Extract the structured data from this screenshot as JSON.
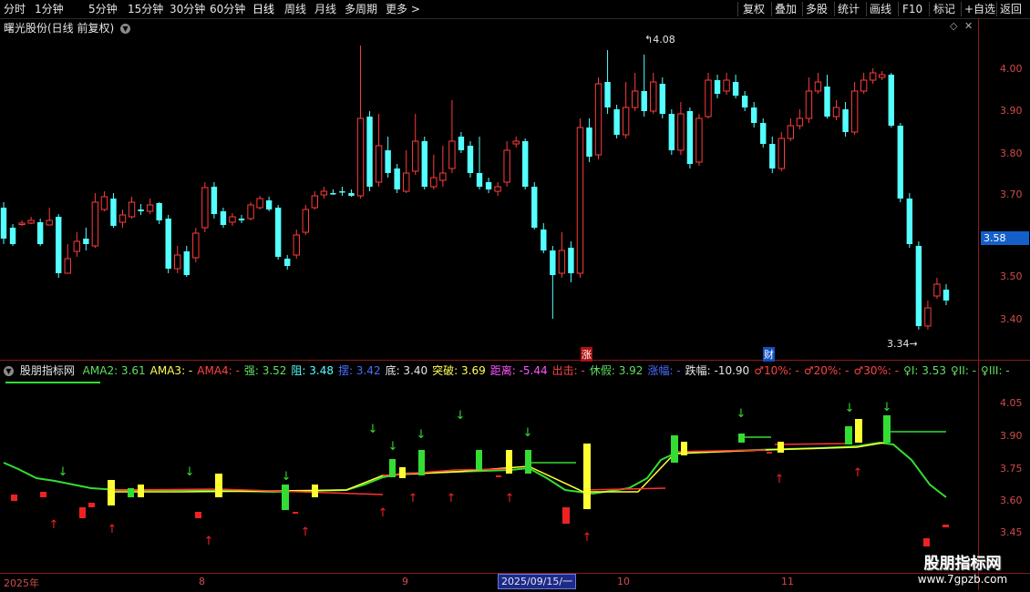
{
  "toolbar": {
    "periods": [
      "分时",
      "1分钟",
      "5分钟",
      "15分钟",
      "30分钟",
      "60分钟",
      "日线",
      "周线",
      "月线",
      "多周期",
      "更多 >"
    ],
    "active_period": "日线",
    "actions": [
      "复权",
      "叠加",
      "多股",
      "统计",
      "画线",
      "F10",
      "标记",
      "+自选",
      "返回"
    ]
  },
  "main_chart": {
    "title": "曙光股份(日线 前复权)",
    "high_label": "4.08",
    "low_label": "3.34",
    "price_tag": "3.58",
    "price_axis": [
      "4.00",
      "3.90",
      "3.80",
      "3.70",
      "3.60",
      "3.50",
      "3.40"
    ],
    "event_tags": [
      "涨",
      "财"
    ],
    "colors": {
      "up": "#ff3b3b",
      "down": "#54ffff",
      "grid": "#8b1a1a",
      "axis_text": "#d24b4b"
    }
  },
  "indicator": {
    "name": "股朋指标网",
    "values": [
      {
        "text": "AMA2: 3.61",
        "color": "#5fe05f"
      },
      {
        "text": "AMA3: -",
        "color": "#ffff55"
      },
      {
        "text": "AMA4: -",
        "color": "#ff4444"
      },
      {
        "text": "强: 3.52",
        "color": "#5fe05f"
      },
      {
        "text": "阻: 3.48",
        "color": "#55ffff"
      },
      {
        "text": "摆: 3.42",
        "color": "#4a6dff"
      },
      {
        "text": "底: 3.40",
        "color": "#e6e6e6"
      },
      {
        "text": "突破: 3.69",
        "color": "#ffff55"
      },
      {
        "text": "距离: -5.44",
        "color": "#ff55ff"
      },
      {
        "text": "出击: -",
        "color": "#ff4444"
      },
      {
        "text": "休假: 3.92",
        "color": "#5fe05f"
      },
      {
        "text": "涨幅: -",
        "color": "#4a6dff"
      },
      {
        "text": "跌幅: -10.90",
        "color": "#e6e6e6"
      },
      {
        "text": "♂10%: -",
        "color": "#ff4444"
      },
      {
        "text": "♂20%: -",
        "color": "#ff4444"
      },
      {
        "text": "♂30%: -",
        "color": "#ff4444"
      },
      {
        "text": "♀I: 3.53",
        "color": "#5fe05f"
      },
      {
        "text": "♀II: -",
        "color": "#5fe05f"
      },
      {
        "text": "♀III: -",
        "color": "#5fe05f"
      }
    ],
    "axis": [
      "4.05",
      "3.90",
      "3.75",
      "3.60",
      "3.45"
    ]
  },
  "date_axis": {
    "labels": [
      "2025年",
      "8",
      "9",
      "10",
      "11"
    ],
    "cursor_date": "2025/09/15/一"
  },
  "watermark": {
    "title": "股朋指标网",
    "url": "www.7gpzb.com"
  }
}
